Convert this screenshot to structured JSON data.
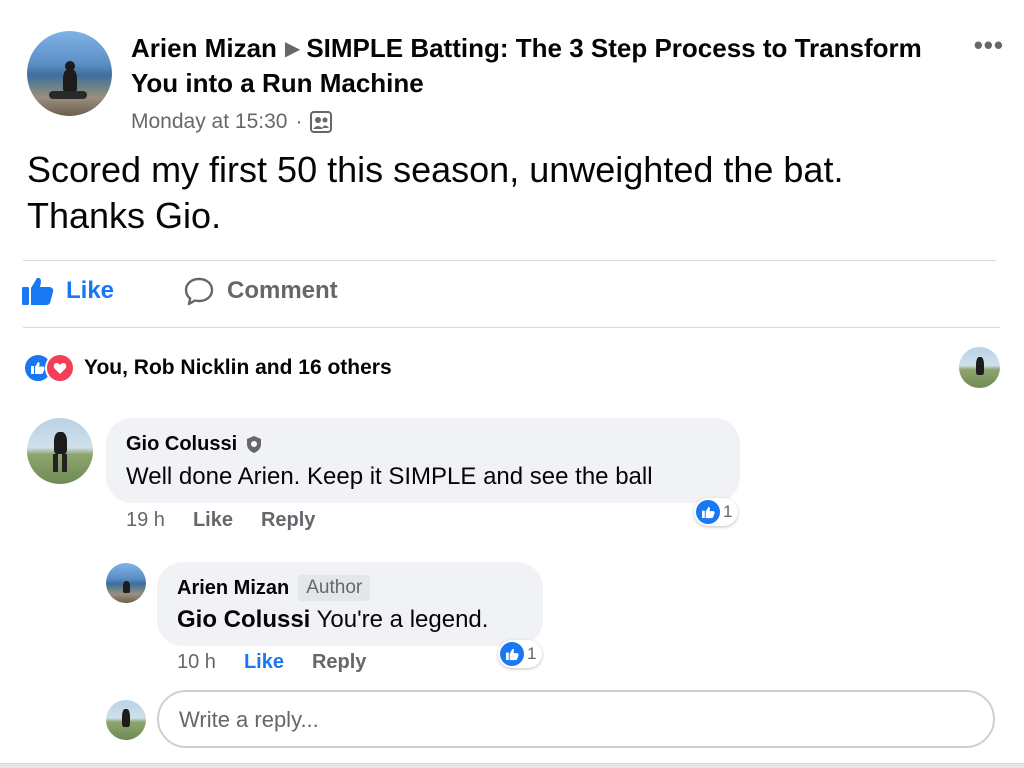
{
  "post": {
    "author": "Arien Mizan",
    "group": "SIMPLE Batting: The 3 Step Process to Transform You into a Run Machine",
    "time": "Monday at 15:30",
    "privacy_icon": "group-members-icon",
    "text_line1": "Scored my first 50 this season, unweighted the bat.",
    "text_line2": "Thanks Gio."
  },
  "actions": {
    "like_label": "Like",
    "comment_label": "Comment"
  },
  "reactions": {
    "summary": "You, Rob Nicklin and 16 others",
    "types": [
      "like",
      "love"
    ]
  },
  "comments": [
    {
      "name": "Gio Colussi",
      "badge_icon": "shield-icon",
      "text": "Well done Arien. Keep it SIMPLE and see the ball",
      "time": "19 h",
      "like_label": "Like",
      "reply_label": "Reply",
      "reaction_count": "1"
    },
    {
      "name": "Arien Mizan",
      "author_badge": "Author",
      "mention": "Gio Colussi",
      "text": " You're a legend.",
      "time": "10 h",
      "like_label": "Like",
      "reply_label": "Reply",
      "reaction_count": "1",
      "liked": true
    }
  ],
  "reply_input": {
    "placeholder": "Write a reply..."
  },
  "colors": {
    "accent": "#1877f2",
    "love": "#f33e58",
    "muted": "#65676b",
    "bubble": "#f0f2f5"
  }
}
